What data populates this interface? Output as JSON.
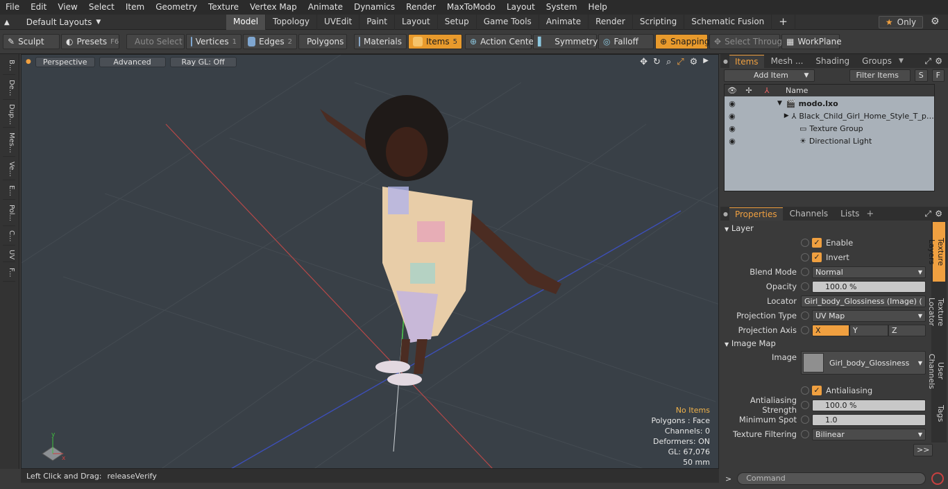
{
  "menubar": [
    "File",
    "Edit",
    "View",
    "Select",
    "Item",
    "Geometry",
    "Texture",
    "Vertex Map",
    "Animate",
    "Dynamics",
    "Render",
    "MaxToModo",
    "Layout",
    "System",
    "Help"
  ],
  "layouts": {
    "label": "Default Layouts",
    "tabs": [
      "Model",
      "Topology",
      "UVEdit",
      "Paint",
      "Layout",
      "Setup",
      "Game Tools",
      "Animate",
      "Render",
      "Scripting",
      "Schematic Fusion"
    ],
    "active": "Model",
    "only_label": "Only"
  },
  "toolbar": {
    "sculpt": "Sculpt",
    "presets": "Presets",
    "presets_key": "F6",
    "auto_select": "Auto Select",
    "vertices": "Vertices",
    "vertices_key": "1",
    "edges": "Edges",
    "edges_key": "2",
    "polygons": "Polygons",
    "materials": "Materials",
    "items": "Items",
    "items_key": "5",
    "action_center": "Action Center",
    "symmetry": "Symmetry",
    "falloff": "Falloff",
    "snapping": "Snapping",
    "select_through": "Select Through",
    "workplane": "WorkPlane"
  },
  "left_tabs": [
    "B...",
    "De...",
    "Dup...",
    "Mes...",
    "Ve...",
    "E...",
    "Pol...",
    "C...",
    "UV",
    "F..."
  ],
  "viewport": {
    "perspective": "Perspective",
    "advanced": "Advanced",
    "raygl": "Ray GL: Off",
    "hud": {
      "no_items": "No Items",
      "polygons": "Polygons : Face",
      "channels": "Channels: 0",
      "deformers": "Deformers: ON",
      "gl": "GL: 67,076",
      "mm": "50 mm"
    }
  },
  "status": {
    "hint": "Left Click and Drag:",
    "action": "releaseVerify"
  },
  "items_panel": {
    "tabs": [
      "Items",
      "Mesh ...",
      "Shading",
      "Groups"
    ],
    "add_item": "Add Item",
    "filter": "Filter Items",
    "s": "S",
    "f": "F",
    "col_name": "Name",
    "rows": [
      {
        "name": "modo.lxo"
      },
      {
        "name": "Black_Child_Girl_Home_Style_T_p ..."
      },
      {
        "name": "Texture Group"
      },
      {
        "name": "Directional Light"
      }
    ]
  },
  "properties": {
    "tabs": [
      "Properties",
      "Channels",
      "Lists"
    ],
    "layer": "Layer",
    "enable": "Enable",
    "invert": "Invert",
    "blend_mode_label": "Blend Mode",
    "blend_mode": "Normal",
    "opacity_label": "Opacity",
    "opacity": "100.0 %",
    "locator_label": "Locator",
    "locator": "Girl_body_Glossiness (Image) ( ...",
    "proj_type_label": "Projection Type",
    "proj_type": "UV Map",
    "proj_axis_label": "Projection Axis",
    "axis_x": "X",
    "axis_y": "Y",
    "axis_z": "Z",
    "image_map": "Image Map",
    "image_label": "Image",
    "image": "Girl_body_Glossiness",
    "antialiasing": "Antialiasing",
    "aa_strength_label": "Antialiasing Strength",
    "aa_strength": "100.0 %",
    "min_spot_label": "Minimum Spot",
    "min_spot": "1.0",
    "tex_filter_label": "Texture Filtering",
    "tex_filter": "Bilinear",
    "more": ">>"
  },
  "side_tabs": [
    "Texture Layers",
    "Texture Locator",
    "User Channels",
    "Tags"
  ],
  "command": {
    "placeholder": "Command"
  }
}
